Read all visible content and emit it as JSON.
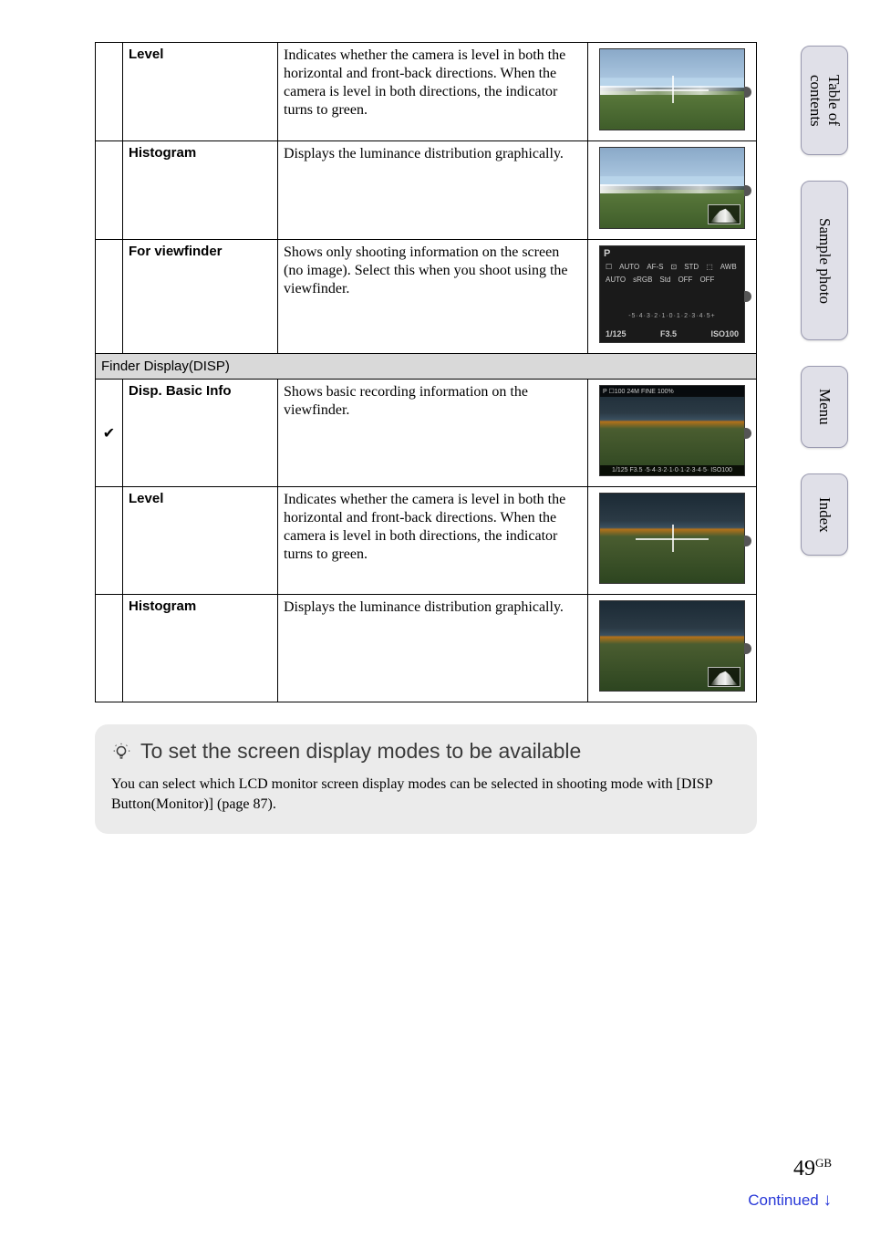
{
  "monitor_rows": [
    {
      "checked": false,
      "name": "Level",
      "desc": "Indicates whether the camera is level in both the horizontal and front-back directions. When the camera is level in both directions, the indicator turns to green.",
      "thumb_type": "level"
    },
    {
      "checked": false,
      "name": "Histogram",
      "desc": "Displays the luminance distribution graphically.",
      "thumb_type": "histogram"
    },
    {
      "checked": false,
      "name": "For viewfinder",
      "desc": "Shows only shooting information on the screen (no image). Select this when you shoot using the viewfinder.",
      "thumb_type": "info",
      "info": {
        "mode": "P",
        "icons_row1": [
          "☐",
          "AUTO",
          "AF-S",
          "⊡",
          "STD",
          "⬚"
        ],
        "icons_row2": [
          "AWB",
          "AUTO",
          "sRGB",
          "Std",
          "OFF",
          "OFF"
        ],
        "ev": "-5·4·3·2·1·0·1·2·3·4·5+",
        "shutter": "1/125",
        "aperture": "F3.5",
        "iso": "ISO100"
      }
    }
  ],
  "finder_section_header": "Finder Display(DISP)",
  "finder_rows": [
    {
      "checked": true,
      "name": "Disp. Basic Info",
      "desc": "Shows basic recording information on the viewfinder.",
      "thumb_type": "finder_basic",
      "finder_top": "P  ☐100  24M  FINE        100%",
      "finder_bot": "1/125   F3.5 ·5·4·3·2·1·0·1·2·3·4·5· ISO100"
    },
    {
      "checked": false,
      "name": "Level",
      "desc": "Indicates whether the camera is level in both the horizontal and front-back directions. When the camera is level in both directions, the indicator turns to green.",
      "thumb_type": "finder_level"
    },
    {
      "checked": false,
      "name": "Histogram",
      "desc": "Displays the luminance distribution graphically.",
      "thumb_type": "finder_hist"
    }
  ],
  "tip": {
    "title": "To set the screen display modes to be available",
    "body": "You can select which LCD monitor screen display modes can be selected in shooting mode with [DISP Button(Monitor)] (page 87)."
  },
  "tabs": {
    "toc": "Table of\ncontents",
    "sample": "Sample photo",
    "menu": "Menu",
    "index": "Index"
  },
  "page_number": "49",
  "page_suffix": "GB",
  "continued": "Continued",
  "check_glyph": "✔"
}
